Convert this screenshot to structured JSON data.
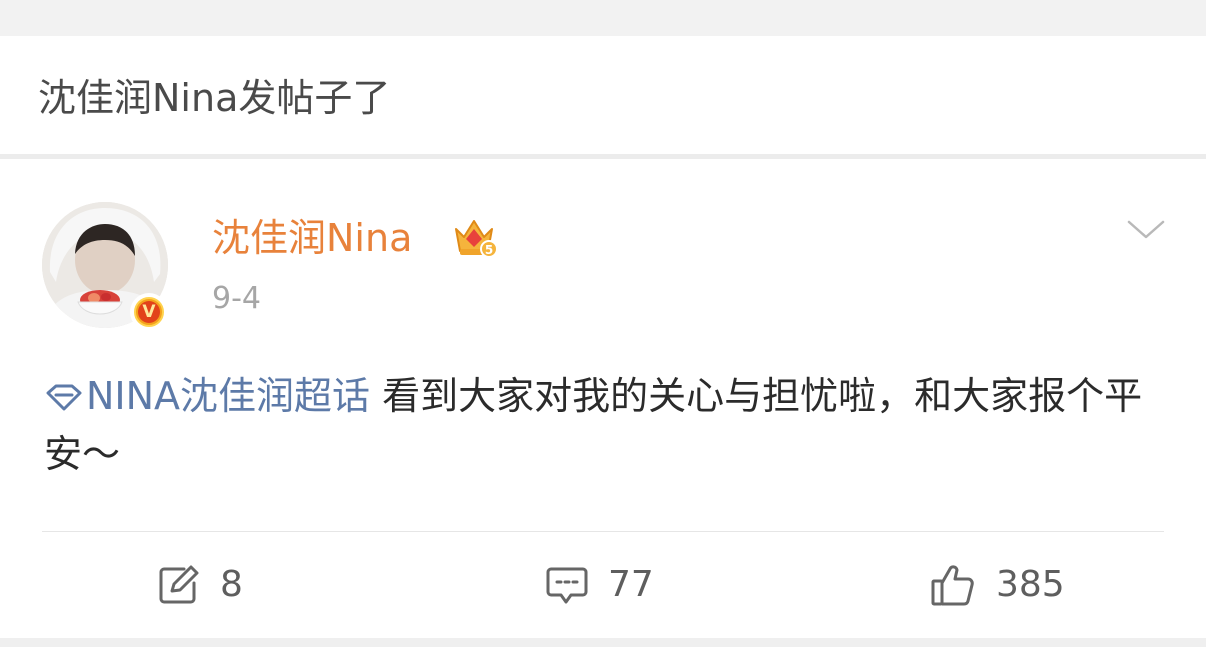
{
  "header": {
    "title": "沈佳润Nina发帖子了"
  },
  "post": {
    "user_name": "沈佳润Nina",
    "time": "9-4",
    "verified_icon": "v-verified-badge",
    "member_icon": "crown-icon",
    "topic": "NINA沈佳润超话",
    "text": " 看到大家对我的关心与担忧啦，和大家报个平安～"
  },
  "actions": {
    "repost_count": "8",
    "comment_count": "77",
    "like_count": "385"
  },
  "colors": {
    "username": "#e8823b",
    "topic_link": "#5d7aa8",
    "text": "#2b2b2b",
    "muted": "#a6a6a6"
  }
}
